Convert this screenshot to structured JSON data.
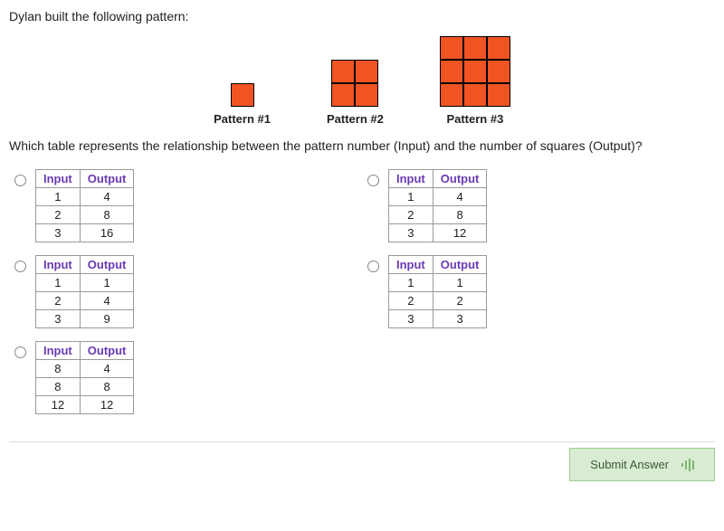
{
  "intro": "Dylan built the following pattern:",
  "patterns": [
    {
      "label": "Pattern #1",
      "size": 1
    },
    {
      "label": "Pattern #2",
      "size": 2
    },
    {
      "label": "Pattern #3",
      "size": 3
    }
  ],
  "question": "Which table represents the relationship between the pattern number (Input) and the number of squares (Output)?",
  "table_headers": {
    "input": "Input",
    "output": "Output"
  },
  "options": [
    {
      "rows": [
        {
          "in": "1",
          "out": "4"
        },
        {
          "in": "2",
          "out": "8"
        },
        {
          "in": "3",
          "out": "16"
        }
      ]
    },
    {
      "rows": [
        {
          "in": "1",
          "out": "4"
        },
        {
          "in": "2",
          "out": "8"
        },
        {
          "in": "3",
          "out": "12"
        }
      ]
    },
    {
      "rows": [
        {
          "in": "1",
          "out": "1"
        },
        {
          "in": "2",
          "out": "4"
        },
        {
          "in": "3",
          "out": "9"
        }
      ]
    },
    {
      "rows": [
        {
          "in": "1",
          "out": "1"
        },
        {
          "in": "2",
          "out": "2"
        },
        {
          "in": "3",
          "out": "3"
        }
      ]
    },
    {
      "rows": [
        {
          "in": "8",
          "out": "4"
        },
        {
          "in": "8",
          "out": "8"
        },
        {
          "in": "12",
          "out": "12"
        }
      ]
    }
  ],
  "submit_label": "Submit Answer",
  "colors": {
    "square": "#f05423",
    "header_text": "#6a3ab2",
    "btn_bg": "#d9ecd3"
  }
}
